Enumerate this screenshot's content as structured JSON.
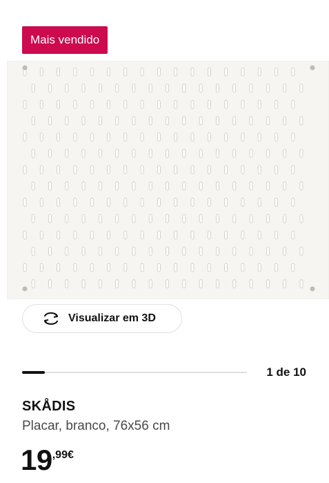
{
  "badge": {
    "label": "Mais vendido",
    "color": "#cc0a4d"
  },
  "image": {
    "alt": "SKÅDIS pegboard",
    "icon": "pegboard-image"
  },
  "view3d": {
    "label": "Visualizar em 3D",
    "icon": "rotate-3d-icon"
  },
  "gallery": {
    "current": 1,
    "total": 10,
    "pager_text": "1 de 10",
    "progress": 0.1
  },
  "product": {
    "name": "SKÅDIS",
    "description": "Placar, branco, 76x56 cm",
    "price_integer": "19",
    "price_decimal": ",99",
    "price_currency": "€"
  }
}
